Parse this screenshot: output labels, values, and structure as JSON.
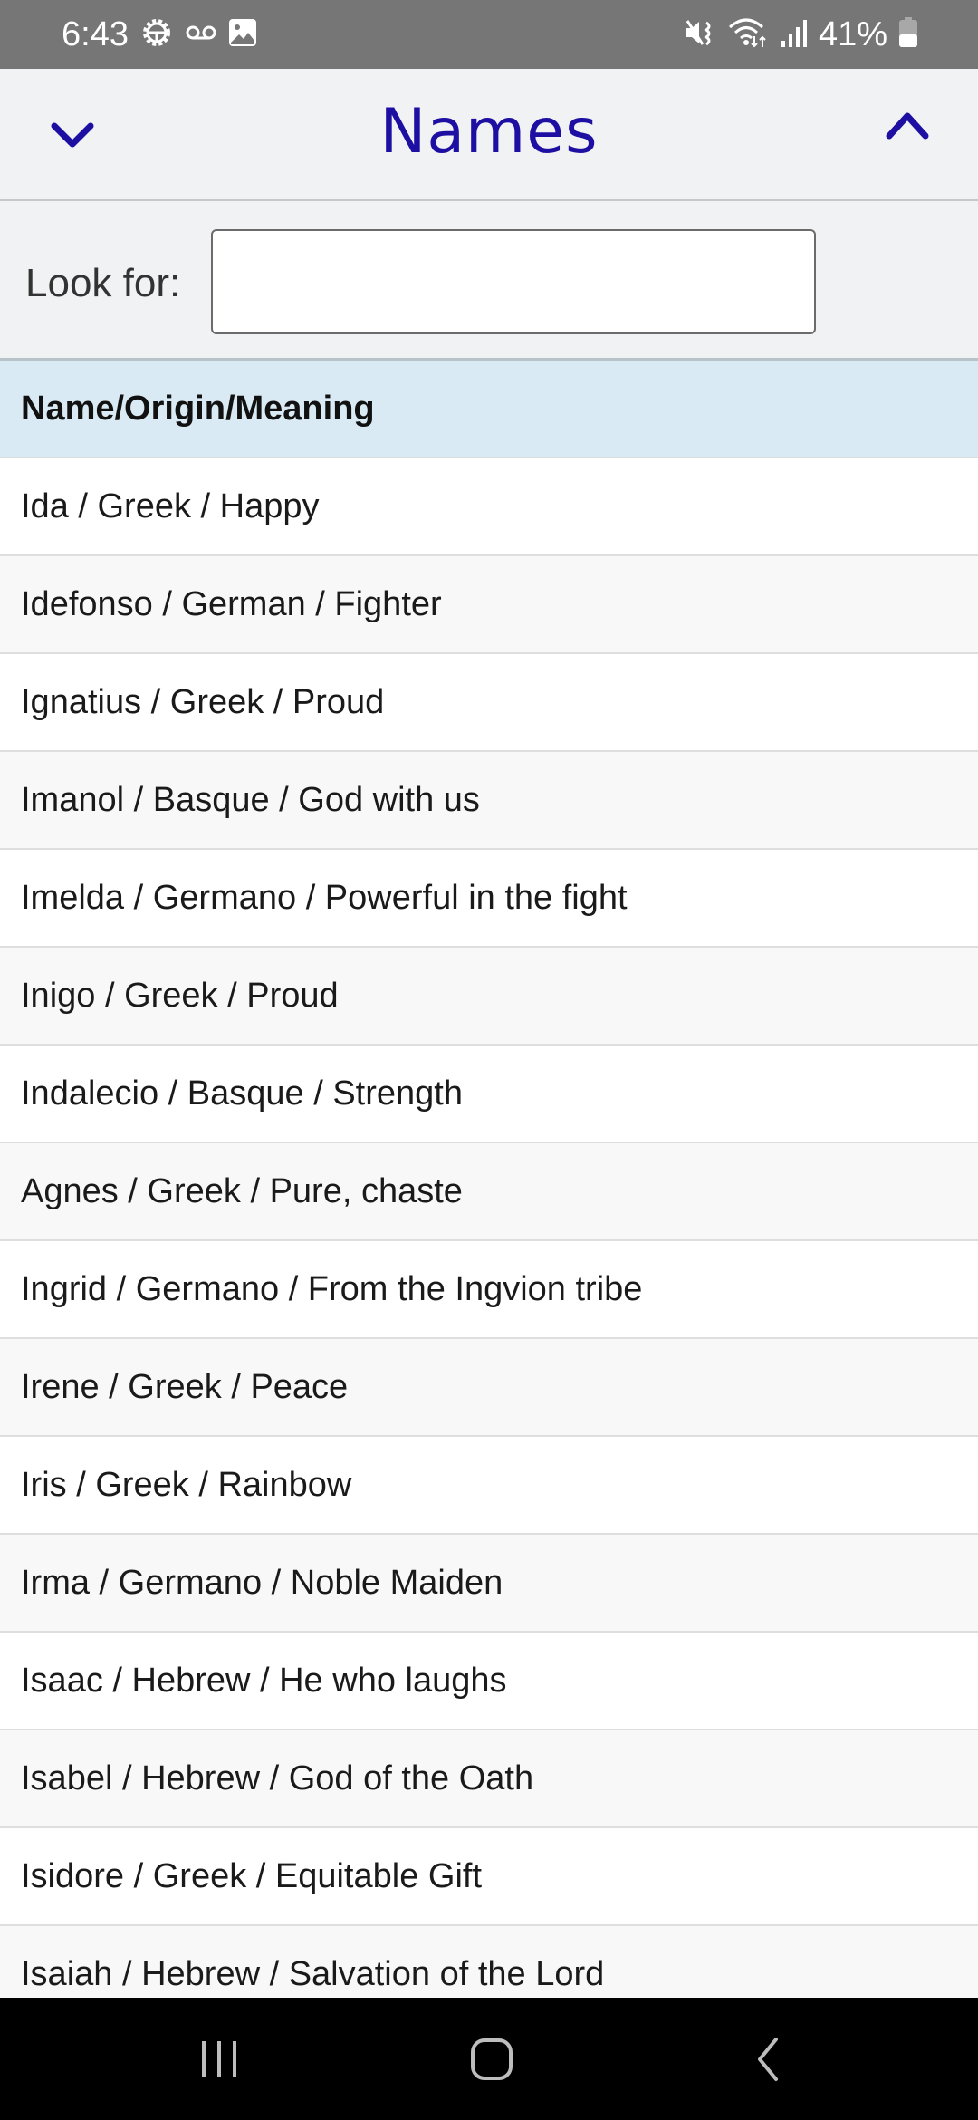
{
  "status_bar": {
    "time": "6:43",
    "left_icons": [
      "android-gear-icon",
      "voicemail-icon",
      "gallery-icon"
    ],
    "right_icons": [
      "mute-vibrate-icon",
      "wifi-data-icon",
      "signal-icon",
      "battery-icon"
    ],
    "battery_percent": "41%"
  },
  "header": {
    "title": "Names",
    "left_button_icon": "chevron-down-icon",
    "right_button_icon": "chevron-up-icon",
    "accent_color": "#1e0fa3"
  },
  "search": {
    "label": "Look for:",
    "value": "",
    "placeholder": ""
  },
  "table": {
    "header": "Name/Origin/Meaning",
    "rows": [
      "Ida / Greek / Happy",
      "Idefonso / German / Fighter",
      "Ignatius / Greek / Proud",
      "Imanol / Basque / God with us",
      "Imelda / Germano / Powerful in the fight",
      "Inigo / Greek / Proud",
      "Indalecio / Basque / Strength",
      "Agnes / Greek / Pure, chaste",
      "Ingrid / Germano / From the Ingvion tribe",
      "Irene / Greek / Peace",
      "Iris / Greek / Rainbow",
      "Irma / Germano / Noble Maiden",
      "Isaac / Hebrew / He who laughs",
      "Isabel / Hebrew / God of the Oath",
      "Isidore / Greek / Equitable Gift",
      "Isaiah / Hebrew / Salvation of the Lord"
    ]
  },
  "nav_bar": {
    "buttons": [
      "recent-apps-icon",
      "home-icon",
      "back-icon"
    ]
  }
}
